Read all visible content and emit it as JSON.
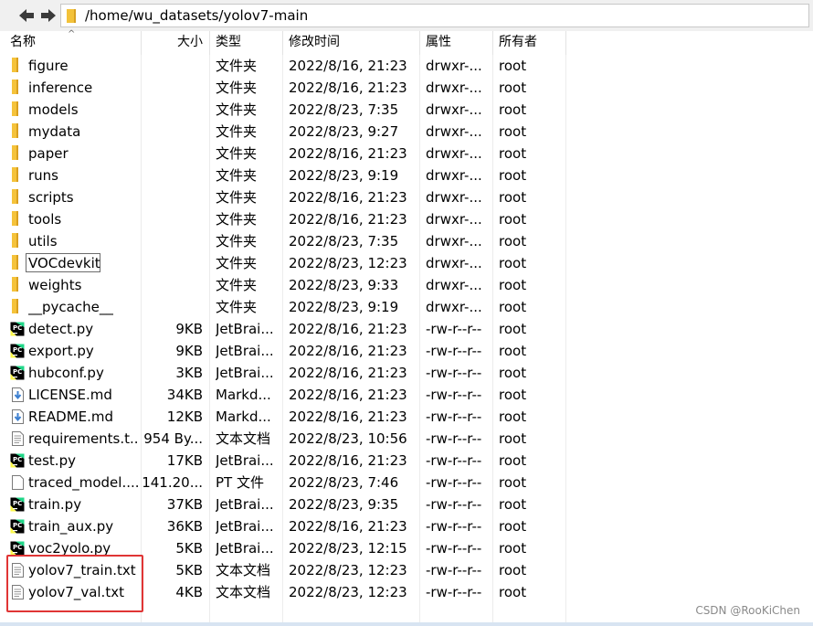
{
  "address_bar": {
    "path": "/home/wu_datasets/yolov7-main"
  },
  "columns": {
    "name": "名称",
    "size": "大小",
    "type": "类型",
    "modified": "修改时间",
    "permissions": "属性",
    "owner": "所有者"
  },
  "files": [
    {
      "name": "figure",
      "size": "",
      "type": "文件夹",
      "modified": "2022/8/16, 21:23",
      "permissions": "drwxr-...",
      "owner": "root",
      "icon": "folder-icon"
    },
    {
      "name": "inference",
      "size": "",
      "type": "文件夹",
      "modified": "2022/8/16, 21:23",
      "permissions": "drwxr-...",
      "owner": "root",
      "icon": "folder-icon"
    },
    {
      "name": "models",
      "size": "",
      "type": "文件夹",
      "modified": "2022/8/23, 7:35",
      "permissions": "drwxr-...",
      "owner": "root",
      "icon": "folder-icon"
    },
    {
      "name": "mydata",
      "size": "",
      "type": "文件夹",
      "modified": "2022/8/23, 9:27",
      "permissions": "drwxr-...",
      "owner": "root",
      "icon": "folder-icon"
    },
    {
      "name": "paper",
      "size": "",
      "type": "文件夹",
      "modified": "2022/8/16, 21:23",
      "permissions": "drwxr-...",
      "owner": "root",
      "icon": "folder-icon"
    },
    {
      "name": "runs",
      "size": "",
      "type": "文件夹",
      "modified": "2022/8/23, 9:19",
      "permissions": "drwxr-...",
      "owner": "root",
      "icon": "folder-icon"
    },
    {
      "name": "scripts",
      "size": "",
      "type": "文件夹",
      "modified": "2022/8/16, 21:23",
      "permissions": "drwxr-...",
      "owner": "root",
      "icon": "folder-icon"
    },
    {
      "name": "tools",
      "size": "",
      "type": "文件夹",
      "modified": "2022/8/16, 21:23",
      "permissions": "drwxr-...",
      "owner": "root",
      "icon": "folder-icon"
    },
    {
      "name": "utils",
      "size": "",
      "type": "文件夹",
      "modified": "2022/8/23, 7:35",
      "permissions": "drwxr-...",
      "owner": "root",
      "icon": "folder-icon"
    },
    {
      "name": "VOCdevkit",
      "size": "",
      "type": "文件夹",
      "modified": "2022/8/23, 12:23",
      "permissions": "drwxr-...",
      "owner": "root",
      "icon": "folder-icon"
    },
    {
      "name": "weights",
      "size": "",
      "type": "文件夹",
      "modified": "2022/8/23, 9:33",
      "permissions": "drwxr-...",
      "owner": "root",
      "icon": "folder-icon"
    },
    {
      "name": "__pycache__",
      "size": "",
      "type": "文件夹",
      "modified": "2022/8/23, 9:19",
      "permissions": "drwxr-...",
      "owner": "root",
      "icon": "folder-icon"
    },
    {
      "name": "detect.py",
      "size": "9KB",
      "type": "JetBrai...",
      "modified": "2022/8/16, 21:23",
      "permissions": "-rw-r--r--",
      "owner": "root",
      "icon": "pycharm-file-icon"
    },
    {
      "name": "export.py",
      "size": "9KB",
      "type": "JetBrai...",
      "modified": "2022/8/16, 21:23",
      "permissions": "-rw-r--r--",
      "owner": "root",
      "icon": "pycharm-file-icon"
    },
    {
      "name": "hubconf.py",
      "size": "3KB",
      "type": "JetBrai...",
      "modified": "2022/8/16, 21:23",
      "permissions": "-rw-r--r--",
      "owner": "root",
      "icon": "pycharm-file-icon"
    },
    {
      "name": "LICENSE.md",
      "size": "34KB",
      "type": "Markd...",
      "modified": "2022/8/16, 21:23",
      "permissions": "-rw-r--r--",
      "owner": "root",
      "icon": "markdown-file-icon"
    },
    {
      "name": "README.md",
      "size": "12KB",
      "type": "Markd...",
      "modified": "2022/8/16, 21:23",
      "permissions": "-rw-r--r--",
      "owner": "root",
      "icon": "markdown-file-icon"
    },
    {
      "name": "requirements.t...",
      "size": "954 By...",
      "type": "文本文档",
      "modified": "2022/8/23, 10:56",
      "permissions": "-rw-r--r--",
      "owner": "root",
      "icon": "text-file-icon"
    },
    {
      "name": "test.py",
      "size": "17KB",
      "type": "JetBrai...",
      "modified": "2022/8/16, 21:23",
      "permissions": "-rw-r--r--",
      "owner": "root",
      "icon": "pycharm-file-icon"
    },
    {
      "name": "traced_model....",
      "size": "141.20...",
      "type": "PT 文件",
      "modified": "2022/8/23, 7:46",
      "permissions": "-rw-r--r--",
      "owner": "root",
      "icon": "blank-file-icon"
    },
    {
      "name": "train.py",
      "size": "37KB",
      "type": "JetBrai...",
      "modified": "2022/8/23, 9:35",
      "permissions": "-rw-r--r--",
      "owner": "root",
      "icon": "pycharm-file-icon"
    },
    {
      "name": "train_aux.py",
      "size": "36KB",
      "type": "JetBrai...",
      "modified": "2022/8/16, 21:23",
      "permissions": "-rw-r--r--",
      "owner": "root",
      "icon": "pycharm-file-icon"
    },
    {
      "name": "voc2yolo.py",
      "size": "5KB",
      "type": "JetBrai...",
      "modified": "2022/8/23, 12:15",
      "permissions": "-rw-r--r--",
      "owner": "root",
      "icon": "pycharm-file-icon"
    },
    {
      "name": "yolov7_train.txt",
      "size": "5KB",
      "type": "文本文档",
      "modified": "2022/8/23, 12:23",
      "permissions": "-rw-r--r--",
      "owner": "root",
      "icon": "text-file-icon"
    },
    {
      "name": "yolov7_val.txt",
      "size": "4KB",
      "type": "文本文档",
      "modified": "2022/8/23, 12:23",
      "permissions": "-rw-r--r--",
      "owner": "root",
      "icon": "text-file-icon"
    }
  ],
  "watermark": "CSDN @RooKiChen",
  "colors": {
    "folder": "#f5c33b",
    "pycharm_icon": "#21d789",
    "highlight_box": "#e03535",
    "markdown_icon": "#3c7fd0"
  }
}
